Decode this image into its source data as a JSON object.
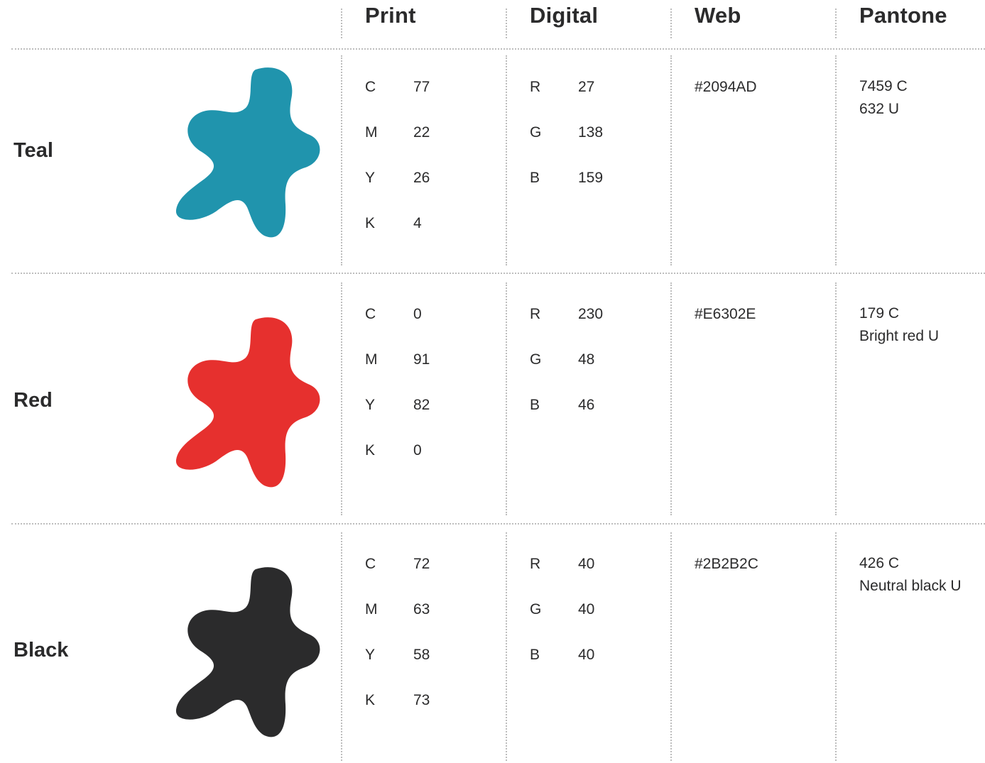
{
  "columns": [
    {
      "key": "print",
      "label": "Print"
    },
    {
      "key": "digital",
      "label": "Digital"
    },
    {
      "key": "web",
      "label": "Web"
    },
    {
      "key": "pantone",
      "label": "Pantone"
    }
  ],
  "swatches": [
    {
      "name": "Teal",
      "color": "#2094AD",
      "print": [
        {
          "label": "C",
          "value": "77"
        },
        {
          "label": "M",
          "value": "22"
        },
        {
          "label": "Y",
          "value": "26"
        },
        {
          "label": "K",
          "value": "4"
        }
      ],
      "digital": [
        {
          "label": "R",
          "value": "27"
        },
        {
          "label": "G",
          "value": "138"
        },
        {
          "label": "B",
          "value": "159"
        }
      ],
      "web": "#2094AD",
      "pantone": [
        "7459 C",
        "632 U"
      ]
    },
    {
      "name": "Red",
      "color": "#E6302E",
      "print": [
        {
          "label": "C",
          "value": "0"
        },
        {
          "label": "M",
          "value": "91"
        },
        {
          "label": "Y",
          "value": "82"
        },
        {
          "label": "K",
          "value": "0"
        }
      ],
      "digital": [
        {
          "label": "R",
          "value": "230"
        },
        {
          "label": "G",
          "value": "48"
        },
        {
          "label": "B",
          "value": "46"
        }
      ],
      "web": "#E6302E",
      "pantone": [
        "179 C",
        "Bright red U"
      ]
    },
    {
      "name": "Black",
      "color": "#2B2B2C",
      "print": [
        {
          "label": "C",
          "value": "72"
        },
        {
          "label": "M",
          "value": "63"
        },
        {
          "label": "Y",
          "value": "58"
        },
        {
          "label": "K",
          "value": "73"
        }
      ],
      "digital": [
        {
          "label": "R",
          "value": "40"
        },
        {
          "label": "G",
          "value": "40"
        },
        {
          "label": "B",
          "value": "40"
        }
      ],
      "web": "#2B2B2C",
      "pantone": [
        "426 C",
        "Neutral black U"
      ]
    }
  ]
}
